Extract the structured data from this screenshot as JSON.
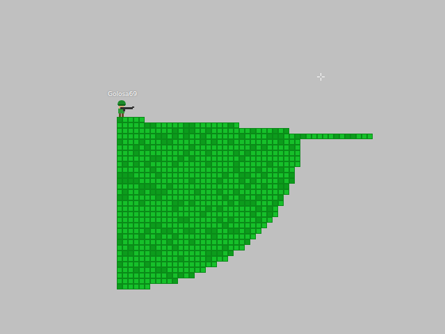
{
  "player": {
    "name": "Golosa69"
  }
}
